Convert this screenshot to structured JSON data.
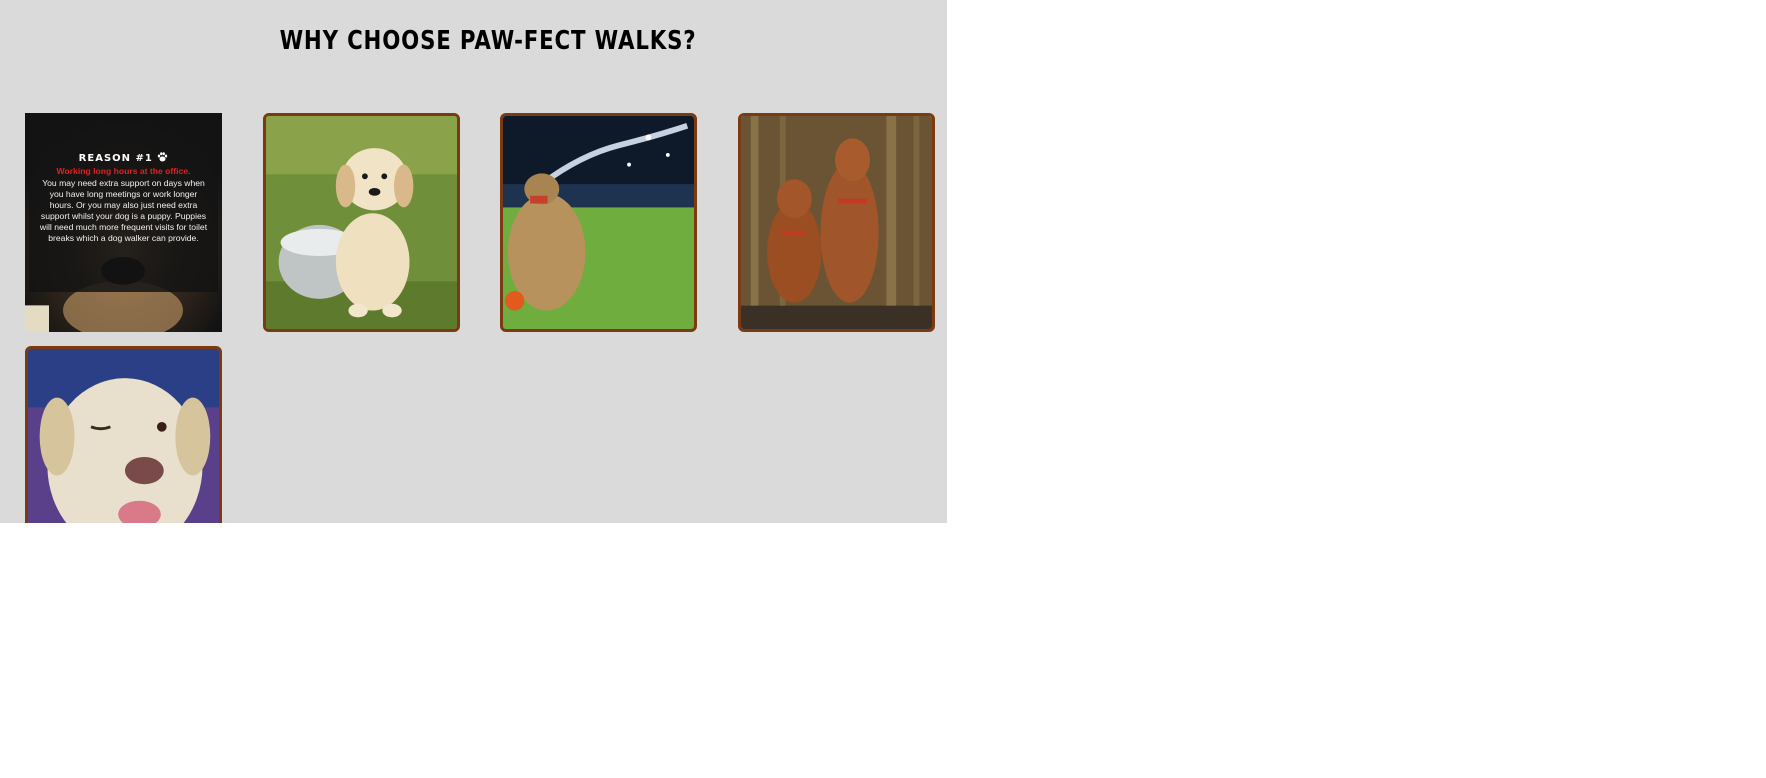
{
  "section": {
    "title": "WHY CHOOSE PAW-FECT WALKS?"
  },
  "cards": [
    {
      "reason_title": "REASON #1",
      "reason_icon": "paw-icon",
      "reason_subtitle": "Working long hours at the office.",
      "reason_body": "You may need extra support on days when you have long meetings or work longer hours. Or you may also just need extra support whilst your dog is a puppy. Puppies will need much more frequent visits for toilet breaks which a dog walker can provide.",
      "image": "black-tan-dog-photo"
    },
    {
      "image": "golden-puppy-in-bowl-photo"
    },
    {
      "image": "terrier-with-water-hose-photo"
    },
    {
      "image": "two-vizsla-dogs-photo"
    },
    {
      "image": "winking-labrador-photo"
    }
  ],
  "colors": {
    "section_bg": "#dadada",
    "card_border": "#7a3a12",
    "reason_subtitle": "#e02020"
  }
}
